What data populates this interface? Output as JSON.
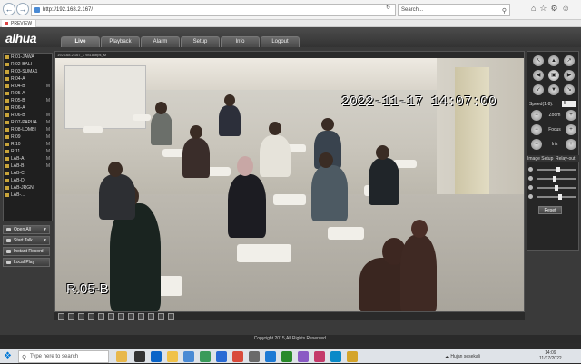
{
  "browser": {
    "address": "http://192.168.2.167/",
    "search_placeholder": "Search...",
    "tab_title": "PREVIEW"
  },
  "app": {
    "logo": "alhua",
    "menu": [
      "Live",
      "Playback",
      "Alarm",
      "Setup",
      "Info",
      "Logout"
    ],
    "active_menu": "Live"
  },
  "channels": [
    {
      "label": "R.01-JAWA",
      "mark": ""
    },
    {
      "label": "R.02-BALI",
      "mark": ""
    },
    {
      "label": "R.03-SUMA1",
      "mark": ""
    },
    {
      "label": "R.04-A",
      "mark": ""
    },
    {
      "label": "R.04-B",
      "mark": "M"
    },
    {
      "label": "R.05-A",
      "mark": ""
    },
    {
      "label": "R.05-B",
      "mark": "M"
    },
    {
      "label": "R.06-A",
      "mark": ""
    },
    {
      "label": "R.06-B",
      "mark": "M"
    },
    {
      "label": "R.07-PAPUA",
      "mark": "M"
    },
    {
      "label": "R.08-LOMBI",
      "mark": "M"
    },
    {
      "label": "R.09",
      "mark": "M"
    },
    {
      "label": "R.10",
      "mark": "M"
    },
    {
      "label": "R.11",
      "mark": "M"
    },
    {
      "label": "LAB-A",
      "mark": "M"
    },
    {
      "label": "LAB-B",
      "mark": "M"
    },
    {
      "label": "LAB-C",
      "mark": ""
    },
    {
      "label": "LAB-D",
      "mark": ""
    },
    {
      "label": "LAB-JRGN",
      "mark": ""
    },
    {
      "label": "LAB-...",
      "mark": ""
    }
  ],
  "left_buttons": {
    "open_all": "Open All",
    "start_talk": "Start Talk",
    "instant_record": "Instant Record",
    "local_play": "Local Play"
  },
  "video": {
    "header": "192.168.2.167_7 9818kbps_M",
    "timestamp": "2022-11-17  14:07:00",
    "camera_name": "R.05-B"
  },
  "ptz": {
    "zoom": "Zoom",
    "focus": "Focus",
    "iris": "Iris",
    "speed_label": "Speed(1-8):",
    "speed_value": "5"
  },
  "image_setup": {
    "title": "Image Setup",
    "relay": "Relay-out",
    "reset": "Reset",
    "levels": [
      0.55,
      0.45,
      0.5,
      0.6
    ]
  },
  "footer": {
    "copyright": "Copyright 2015,All Rights Reserved."
  },
  "taskbar": {
    "search": "Type here to search",
    "weather": "Hujan sesekali",
    "time": "14:09",
    "date": "11/17/2022"
  }
}
